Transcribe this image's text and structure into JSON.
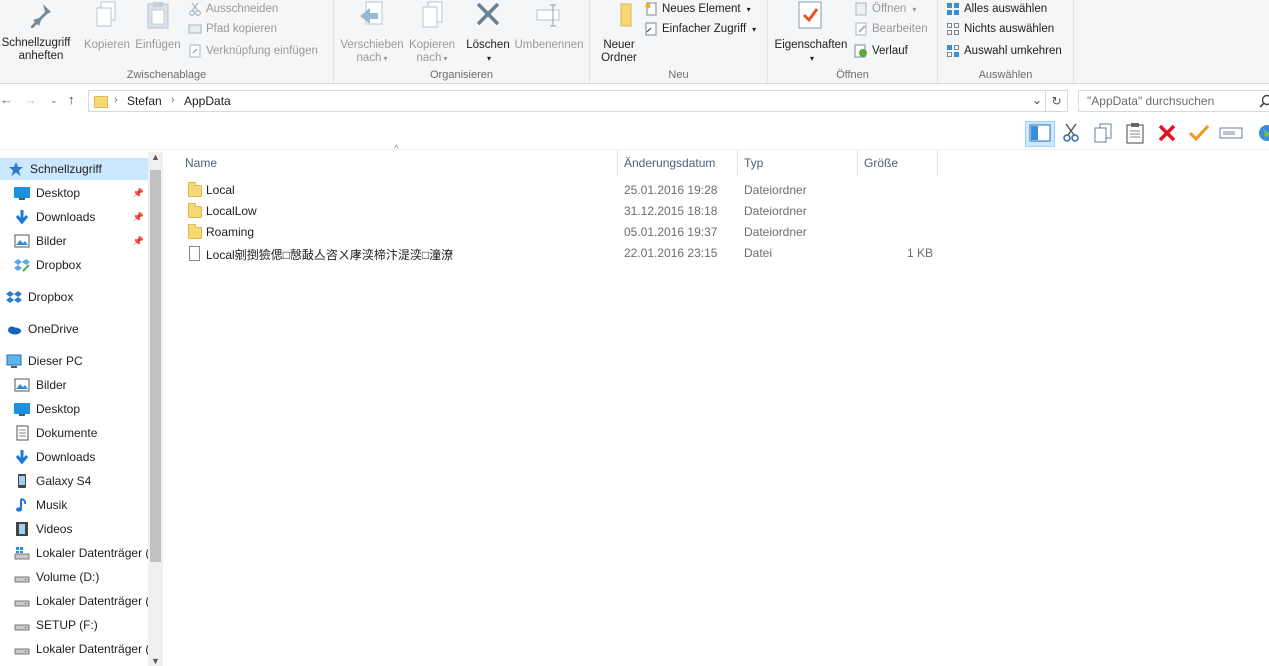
{
  "ribbon": {
    "clipboard": {
      "label": "Zwischenablage",
      "pin_label_1": "Schnellzugriff",
      "pin_label_2": "anheften",
      "copy_label": "Kopieren",
      "paste_label": "Einfügen",
      "cut_label": "Ausschneiden",
      "copy_path_label": "Pfad kopieren",
      "paste_shortcut_label": "Verknüpfung einfügen"
    },
    "organize": {
      "label": "Organisieren",
      "move_label_1": "Verschieben",
      "move_label_2": "nach",
      "copyto_label_1": "Kopieren",
      "copyto_label_2": "nach",
      "delete_label": "Löschen",
      "rename_label": "Umbenennen"
    },
    "new": {
      "label": "Neu",
      "newfolder_label_1": "Neuer",
      "newfolder_label_2": "Ordner",
      "new_item_label": "Neues Element",
      "easy_access_label": "Einfacher Zugriff"
    },
    "open": {
      "label": "Öffnen",
      "properties_label": "Eigenschaften",
      "open_label": "Öffnen",
      "edit_label": "Bearbeiten",
      "history_label": "Verlauf"
    },
    "select": {
      "label": "Auswählen",
      "select_all_label": "Alles auswählen",
      "select_none_label": "Nichts auswählen",
      "invert_label": "Auswahl umkehren"
    }
  },
  "address": {
    "crumbs": [
      "Stefan",
      "AppData"
    ],
    "search_placeholder": "\"AppData\" durchsuchen"
  },
  "nav": {
    "items": [
      {
        "label": "Schnellzugriff",
        "icon": "star-icon"
      },
      {
        "label": "Desktop",
        "icon": "desktop-icon"
      },
      {
        "label": "Downloads",
        "icon": "download-icon"
      },
      {
        "label": "Bilder",
        "icon": "pictures-icon"
      },
      {
        "label": "Dropbox",
        "icon": "dropbox-icon"
      },
      {
        "label": "Dropbox",
        "icon": "dropbox-icon"
      },
      {
        "label": "OneDrive",
        "icon": "onedrive-icon"
      },
      {
        "label": "Dieser PC",
        "icon": "pc-icon"
      },
      {
        "label": "Bilder",
        "icon": "pictures-icon"
      },
      {
        "label": "Desktop",
        "icon": "desktop-icon"
      },
      {
        "label": "Dokumente",
        "icon": "documents-icon"
      },
      {
        "label": "Downloads",
        "icon": "download-icon"
      },
      {
        "label": "Galaxy S4",
        "icon": "phone-icon"
      },
      {
        "label": "Musik",
        "icon": "music-icon"
      },
      {
        "label": "Videos",
        "icon": "videos-icon"
      },
      {
        "label": "Lokaler Datenträger (C:)",
        "icon": "system-drive-icon"
      },
      {
        "label": "Volume (D:)",
        "icon": "drive-icon"
      },
      {
        "label": "Lokaler Datenträger (E:)",
        "icon": "drive-icon"
      },
      {
        "label": "SETUP (F:)",
        "icon": "drive-icon"
      },
      {
        "label": "Lokaler Datenträger (G:)",
        "icon": "drive-icon"
      }
    ]
  },
  "files": {
    "columns": {
      "name": "Name",
      "date": "Änderungsdatum",
      "type": "Typ",
      "size": "Größe"
    },
    "rows": [
      {
        "name": "Local",
        "date": "25.01.2016 19:28",
        "type": "Dateiordner",
        "size": "",
        "kind": "folder"
      },
      {
        "name": "LocalLow",
        "date": "31.12.2015 18:18",
        "type": "Dateiordner",
        "size": "",
        "kind": "folder"
      },
      {
        "name": "Roaming",
        "date": "05.01.2016 19:37",
        "type": "Dateiordner",
        "size": "",
        "kind": "folder"
      },
      {
        "name": "Local剜捯獫偲□慤敮亼咨ㄨ庨湙楴汴湜湙□潼潦",
        "date": "22.01.2016 23:15",
        "type": "Datei",
        "size": "1 KB",
        "kind": "file"
      }
    ]
  },
  "colors": {
    "accent": "#0078d7",
    "selection": "#cce8ff",
    "folder": "#f8d775",
    "delete_red": "#e81123",
    "check_orange": "#f7941d"
  }
}
